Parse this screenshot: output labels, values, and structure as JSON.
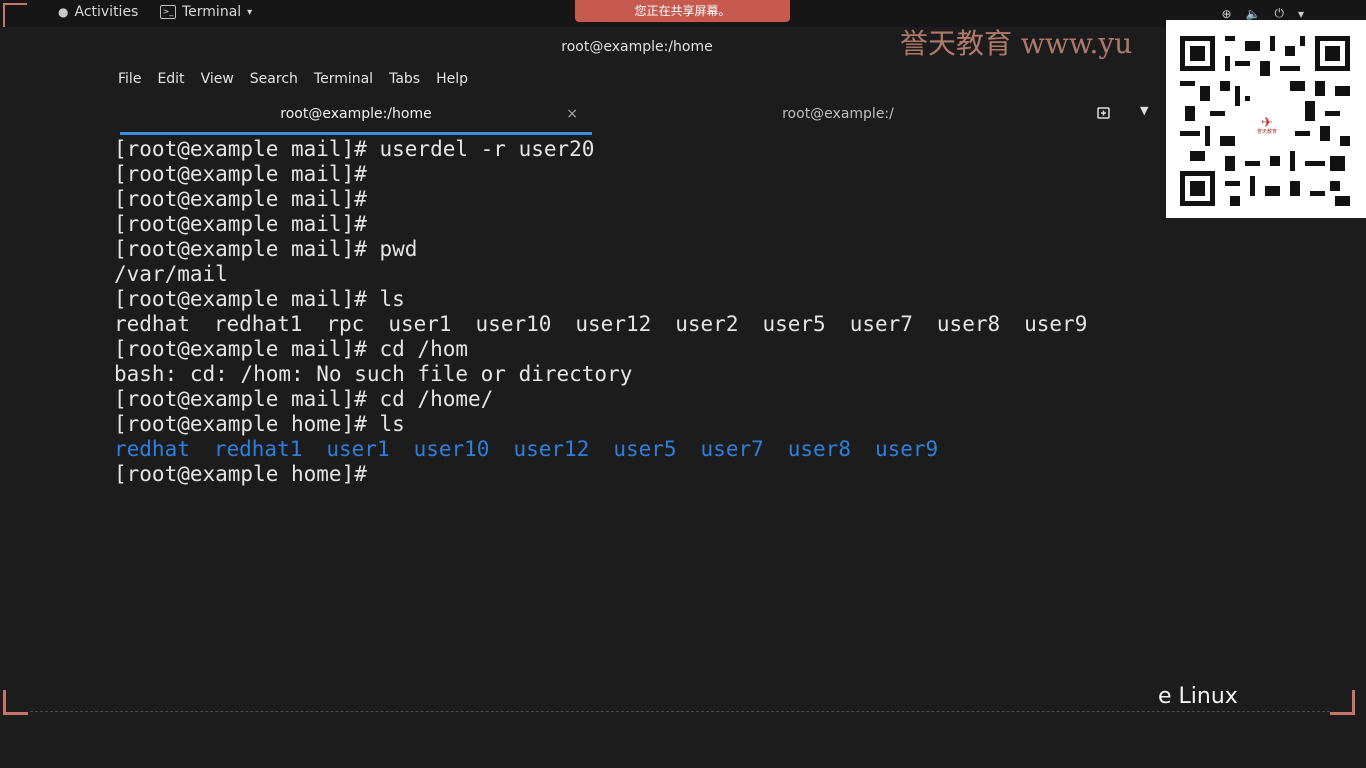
{
  "topbar": {
    "activities": "Activities",
    "app_name": "Terminal",
    "caret": "▾",
    "tray": {
      "network": "⊕",
      "volume": "🔈",
      "power": "⏻",
      "caret": "▾"
    }
  },
  "share_banner": "您正在共享屏幕。",
  "window": {
    "title": "root@example:/home"
  },
  "menu": [
    "File",
    "Edit",
    "View",
    "Search",
    "Terminal",
    "Tabs",
    "Help"
  ],
  "tabs": [
    {
      "label": "root@example:/home",
      "active": true,
      "close": "×"
    },
    {
      "label": "root@example:/",
      "active": false
    }
  ],
  "terminal": {
    "lines": [
      "[root@example mail]# userdel -r user20",
      "[root@example mail]#",
      "[root@example mail]#",
      "[root@example mail]#",
      "[root@example mail]# pwd",
      "/var/mail",
      "[root@example mail]# ls"
    ],
    "ls1": [
      "redhat",
      "redhat1",
      "rpc",
      "user1",
      "user10",
      "user12",
      "user2",
      "user5",
      "user7",
      "user8",
      "user9"
    ],
    "lines2": [
      "[root@example mail]# cd /hom",
      "bash: cd: /hom: No such file or directory",
      "[root@example mail]# cd /home/",
      "[root@example home]# ls"
    ],
    "ls2": [
      "redhat",
      "redhat1",
      "user1",
      "user10",
      "user12",
      "user5",
      "user7",
      "user8",
      "user9"
    ],
    "prompt": "[root@example home]#"
  },
  "watermark": "誉天教育 www.yu",
  "qr_logo_text": "誉天教育",
  "brand_linux": "e Linux",
  "colors": {
    "accent": "#3d8ee8",
    "ls_blue": "#2d7fde",
    "banner": "#c75a4f",
    "watermark": "#c98a76"
  }
}
